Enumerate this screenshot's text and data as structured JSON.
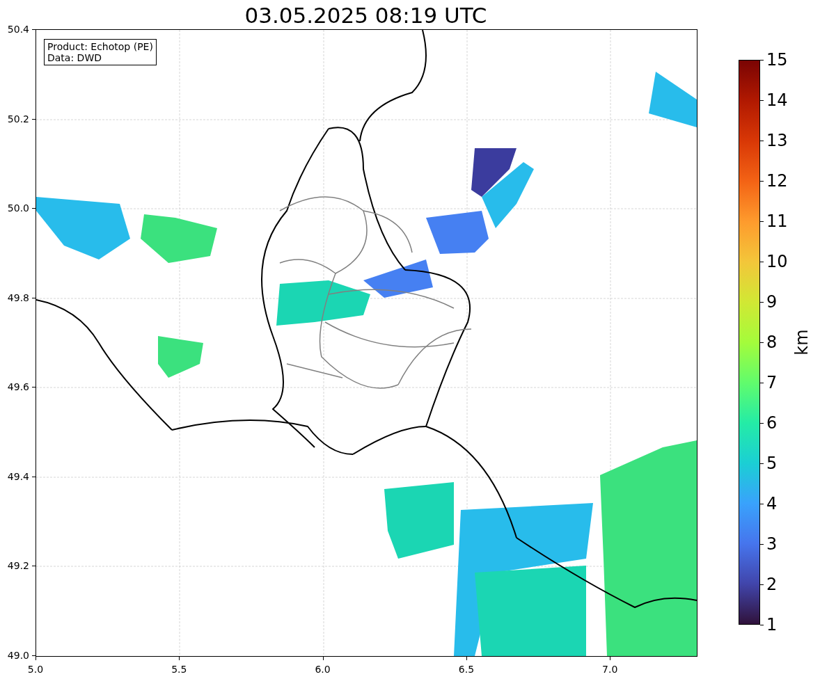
{
  "title": "03.05.2025 08:19 UTC",
  "info_box": {
    "lines": [
      "Product: Echotop (PE)",
      "Data: DWD"
    ]
  },
  "y_axis": {
    "ticks": [
      "50.4",
      "50.2",
      "50.0",
      "49.8",
      "49.6",
      "49.4",
      "49.2",
      "49.0"
    ]
  },
  "x_axis": {
    "ticks": [
      "5.0",
      "5.5",
      "6.0",
      "6.5",
      "7.0"
    ]
  },
  "colorbar": {
    "label": "km",
    "ticks": [
      "15",
      "14",
      "13",
      "12",
      "11",
      "10",
      "9",
      "8",
      "7",
      "6",
      "5",
      "4",
      "3",
      "2",
      "1"
    ]
  }
}
